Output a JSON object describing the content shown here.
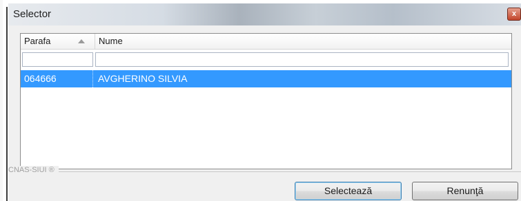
{
  "window": {
    "title": "Selector",
    "close_glyph": "x"
  },
  "grid": {
    "columns": [
      "Parafa",
      "Nume"
    ],
    "sort_column": "Parafa",
    "sort_direction": "ascending",
    "filters": [
      "",
      ""
    ],
    "rows": [
      {
        "parafa": "064666",
        "nume": "AVGHERINO SILVIA",
        "selected": true
      }
    ]
  },
  "footer": {
    "group_label": "CNAS-SIUI ®",
    "select_button": "Selectează",
    "cancel_button": "Renunţă"
  },
  "colors": {
    "selection": "#3399ff",
    "window_bg": "#f0f0f0"
  }
}
